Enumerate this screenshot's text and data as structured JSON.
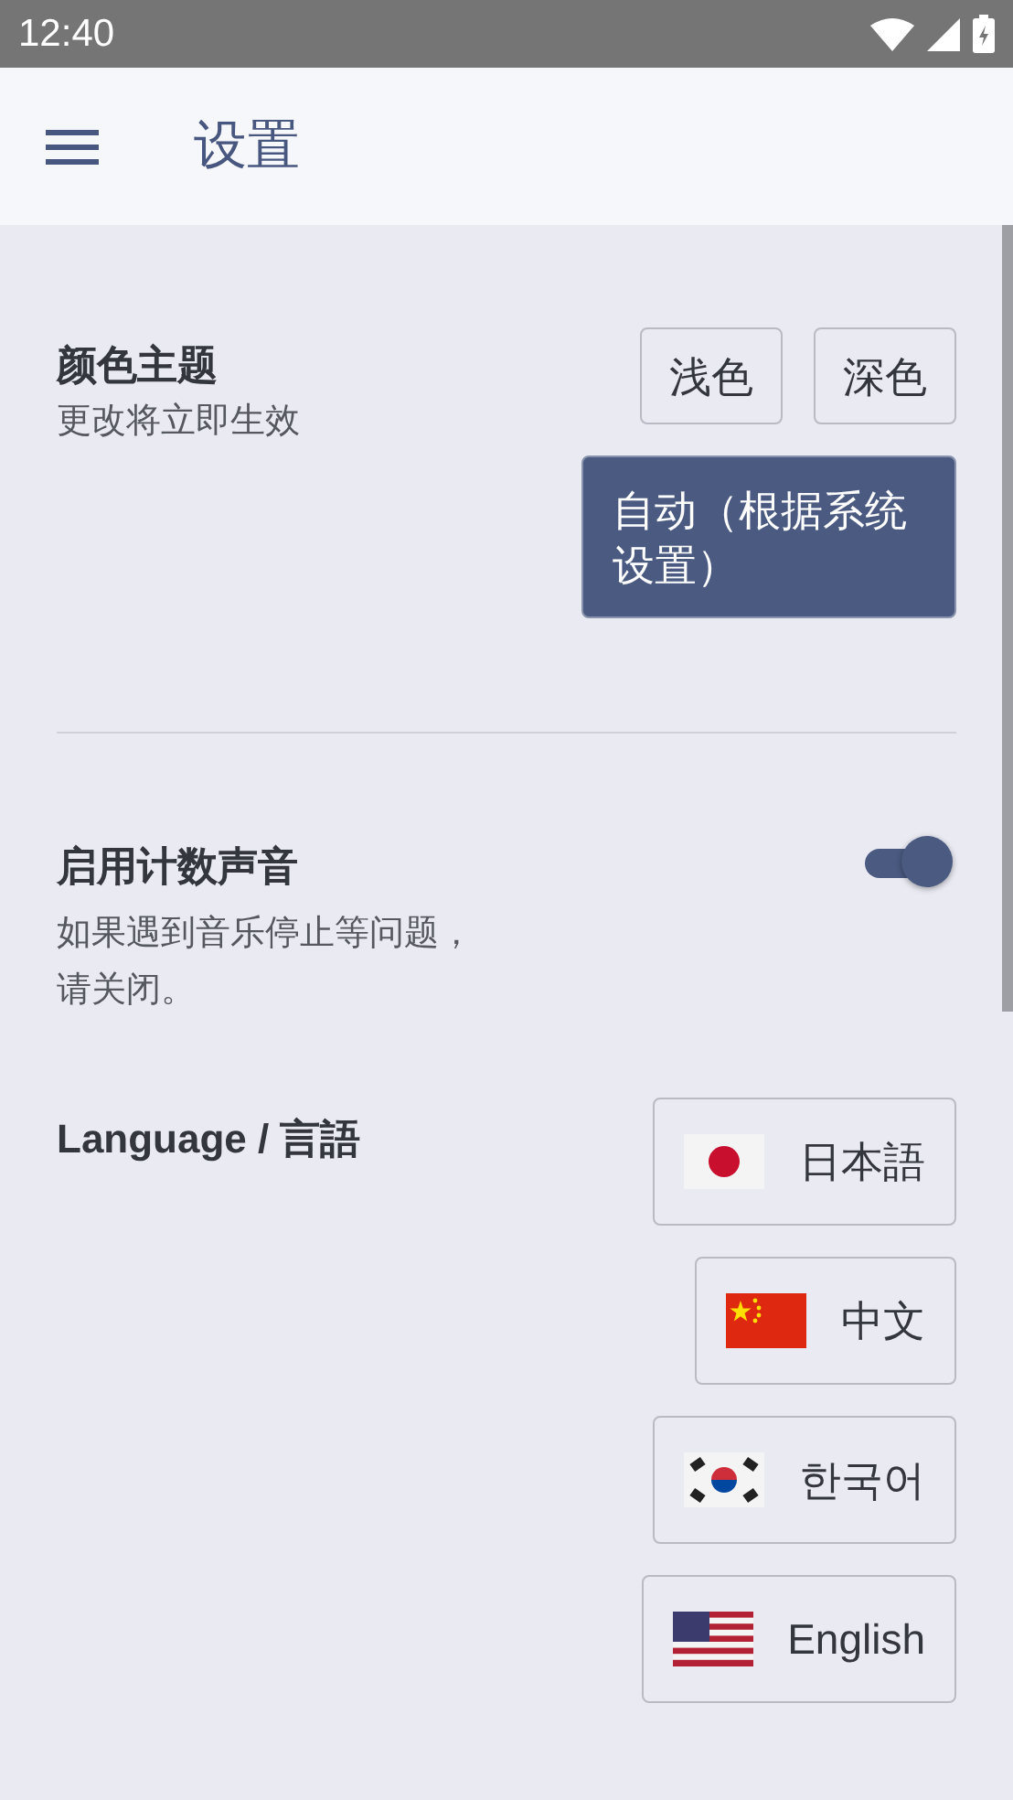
{
  "status_bar": {
    "time": "12:40"
  },
  "app_bar": {
    "title": "设置"
  },
  "theme": {
    "title": "颜色主题",
    "subtitle": "更改将立即生效",
    "options": [
      {
        "label": "浅色",
        "selected": false
      },
      {
        "label": "深色",
        "selected": false
      },
      {
        "label": "自动（根据系统设置）",
        "selected": true
      }
    ]
  },
  "count_sound": {
    "title": "启用计数声音",
    "description": "如果遇到音乐停止等问题，请关闭。",
    "on": true
  },
  "language": {
    "title": "Language / 言語",
    "options": [
      {
        "label": "日本語",
        "kind": "jp"
      },
      {
        "label": "中文",
        "kind": "cn"
      },
      {
        "label": "한국어",
        "kind": "kr"
      },
      {
        "label": "English",
        "kind": "us"
      }
    ]
  }
}
